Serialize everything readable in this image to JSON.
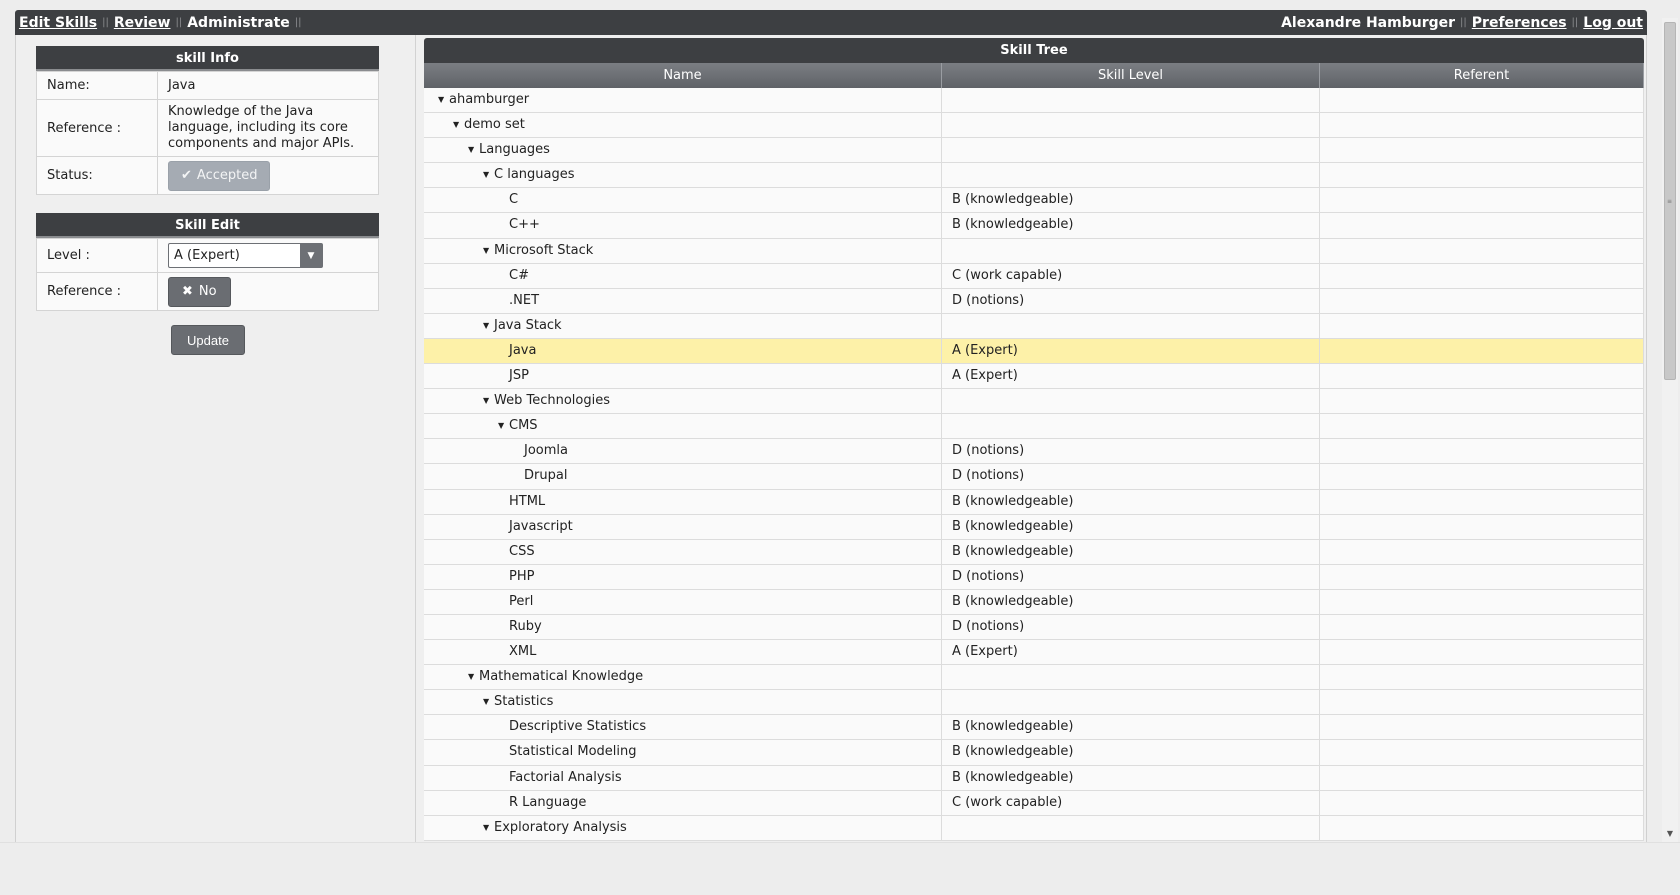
{
  "nav": {
    "items": [
      {
        "label": "Edit Skills",
        "link": true
      },
      {
        "label": "Review",
        "link": true
      },
      {
        "label": "Administrate",
        "link": false
      }
    ],
    "user_name": "Alexandre Hamburger",
    "preferences": "Preferences",
    "logout": "Log out"
  },
  "skill_info": {
    "title": "skill Info",
    "name_label": "Name:",
    "name_value": "Java",
    "reference_label": "Reference :",
    "reference_value": "Knowledge of the Java language, including its core components and major APIs.",
    "status_label": "Status:",
    "status_value": "Accepted"
  },
  "skill_edit": {
    "title": "Skill Edit",
    "level_label": "Level :",
    "level_value": "A (Expert)",
    "reference_label": "Reference :",
    "reference_value": "No",
    "update": "Update"
  },
  "tree": {
    "title": "Skill Tree",
    "columns": [
      "Name",
      "Skill Level",
      "Referent"
    ],
    "rows": [
      {
        "name": "ahamburger",
        "depth": 0,
        "expanded": true,
        "level": ""
      },
      {
        "name": "demo set",
        "depth": 1,
        "expanded": true,
        "level": ""
      },
      {
        "name": "Languages",
        "depth": 2,
        "expanded": true,
        "level": ""
      },
      {
        "name": "C languages",
        "depth": 3,
        "expanded": true,
        "level": ""
      },
      {
        "name": "C",
        "depth": 4,
        "level": "B (knowledgeable)"
      },
      {
        "name": "C++",
        "depth": 4,
        "level": "B (knowledgeable)"
      },
      {
        "name": "Microsoft Stack",
        "depth": 3,
        "expanded": true,
        "level": ""
      },
      {
        "name": "C#",
        "depth": 4,
        "level": "C (work capable)"
      },
      {
        "name": ".NET",
        "depth": 4,
        "level": "D (notions)"
      },
      {
        "name": "Java Stack",
        "depth": 3,
        "expanded": true,
        "level": ""
      },
      {
        "name": "Java",
        "depth": 4,
        "level": "A (Expert)",
        "selected": true
      },
      {
        "name": "JSP",
        "depth": 4,
        "level": "A (Expert)"
      },
      {
        "name": "Web Technologies",
        "depth": 3,
        "expanded": true,
        "level": ""
      },
      {
        "name": "CMS",
        "depth": 4,
        "expanded": true,
        "level": ""
      },
      {
        "name": "Joomla",
        "depth": 5,
        "level": "D (notions)"
      },
      {
        "name": "Drupal",
        "depth": 5,
        "level": "D (notions)"
      },
      {
        "name": "HTML",
        "depth": 4,
        "level": "B (knowledgeable)"
      },
      {
        "name": "Javascript",
        "depth": 4,
        "level": "B (knowledgeable)"
      },
      {
        "name": "CSS",
        "depth": 4,
        "level": "B (knowledgeable)"
      },
      {
        "name": "PHP",
        "depth": 4,
        "level": "D (notions)"
      },
      {
        "name": "Perl",
        "depth": 4,
        "level": "B (knowledgeable)"
      },
      {
        "name": "Ruby",
        "depth": 4,
        "level": "D (notions)"
      },
      {
        "name": "XML",
        "depth": 4,
        "level": "A (Expert)"
      },
      {
        "name": "Mathematical Knowledge",
        "depth": 2,
        "expanded": true,
        "level": ""
      },
      {
        "name": "Statistics",
        "depth": 3,
        "expanded": true,
        "level": ""
      },
      {
        "name": "Descriptive Statistics",
        "depth": 4,
        "level": "B (knowledgeable)"
      },
      {
        "name": "Statistical Modeling",
        "depth": 4,
        "level": "B (knowledgeable)"
      },
      {
        "name": "Factorial Analysis",
        "depth": 4,
        "level": "B (knowledgeable)"
      },
      {
        "name": "R Language",
        "depth": 4,
        "level": "C (work capable)"
      },
      {
        "name": "Exploratory Analysis",
        "depth": 3,
        "expanded": true,
        "level": ""
      }
    ]
  },
  "icons": {
    "expanded": "triangle-down-icon",
    "accepted": "check-icon",
    "no": "x-icon",
    "dropdown": "chevron-down-icon"
  },
  "colors": {
    "header": "#3d3f42",
    "selected_row": "#fdf1a8",
    "button": "#6a6d72"
  }
}
